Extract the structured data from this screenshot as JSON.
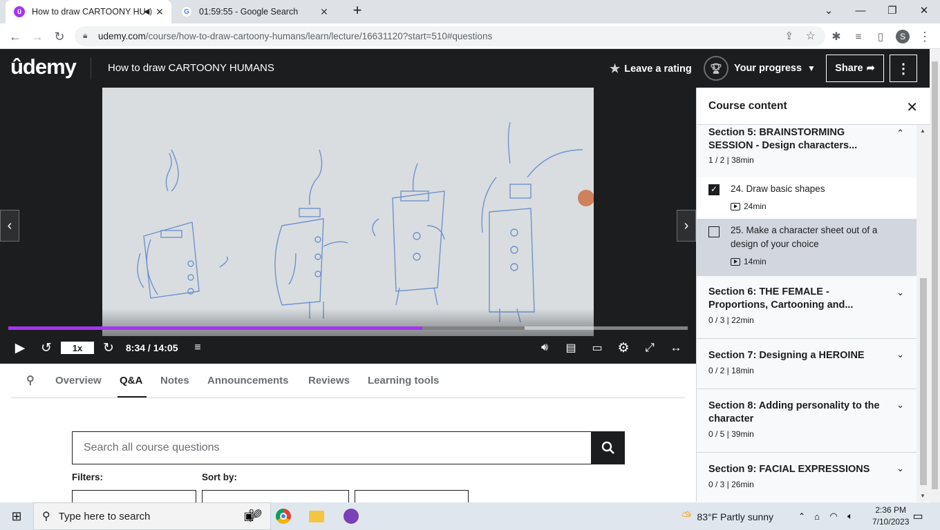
{
  "browser": {
    "tabs": [
      {
        "title": "How to draw CARTOONY HU",
        "active": true
      },
      {
        "title": "01:59:55 - Google Search",
        "active": false
      }
    ],
    "url_host": "udemy.com",
    "url_path": "/course/how-to-draw-cartoony-humans/learn/lecture/16631120?start=510#questions",
    "profile_initial": "S"
  },
  "header": {
    "logo": "ûdemy",
    "course_title": "How to draw CARTOONY HUMANS",
    "rating_label": "Leave a rating",
    "progress_label": "Your progress",
    "share_label": "Share"
  },
  "player": {
    "speed": "1x",
    "time": "8:34 / 14:05",
    "progress_fraction": 0.609,
    "buffered_fraction": 0.76
  },
  "tabs": {
    "items": [
      "Overview",
      "Q&A",
      "Notes",
      "Announcements",
      "Reviews",
      "Learning tools"
    ],
    "active": "Q&A"
  },
  "qa": {
    "search_placeholder": "Search all course questions",
    "filters_label": "Filters:",
    "sort_label": "Sort by:"
  },
  "sidebar": {
    "title": "Course content",
    "sections": [
      {
        "title": "Section 5: BRAINSTORMING SESSION - Design characters...",
        "meta": "1 / 2 | 38min",
        "expanded": true,
        "lessons": [
          {
            "title": "24. Draw basic shapes",
            "duration": "24min",
            "done": true
          },
          {
            "title": "25. Make a character sheet out of a design of your choice",
            "duration": "14min",
            "done": false
          }
        ]
      },
      {
        "title": "Section 6: THE FEMALE - Proportions, Cartooning and...",
        "meta": "0 / 3 | 22min",
        "expanded": false
      },
      {
        "title": "Section 7: Designing a HEROINE",
        "meta": "0 / 2 | 18min",
        "expanded": false
      },
      {
        "title": "Section 8: Adding personality to the character",
        "meta": "0 / 5 | 39min",
        "expanded": false
      },
      {
        "title": "Section 9: FACIAL EXPRESSIONS",
        "meta": "0 / 3 | 26min",
        "expanded": false
      }
    ]
  },
  "taskbar": {
    "search_placeholder": "Type here to search",
    "weather": "83°F  Partly sunny",
    "time": "2:36 PM",
    "date": "7/10/2023"
  },
  "colors": {
    "accent": "#a435f0",
    "header_bg": "#1c1d1f"
  }
}
